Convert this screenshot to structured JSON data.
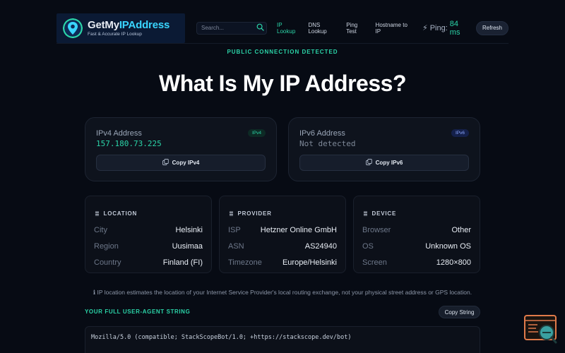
{
  "brand": {
    "title_main": "GetMy",
    "title_accent": "IPAddress",
    "tagline": "Fast & Accurate IP Lookup"
  },
  "search": {
    "placeholder": "Search..."
  },
  "nav": {
    "items": [
      {
        "label": "IP Lookup",
        "active": true
      },
      {
        "label": "DNS Lookup",
        "active": false
      },
      {
        "label": "Ping Test",
        "active": false
      },
      {
        "label": "Hostname to IP",
        "active": false
      }
    ]
  },
  "ping": {
    "label": "Ping:",
    "value": "84 ms"
  },
  "refresh_label": "Refresh",
  "status": "PUBLIC CONNECTION DETECTED",
  "page_title": "What Is My IP Address?",
  "ipv4": {
    "label": "IPv4 Address",
    "badge": "IPv4",
    "address": "157.180.73.225",
    "copy_label": "Copy IPv4"
  },
  "ipv6": {
    "label": "IPv6 Address",
    "badge": "IPv6",
    "address": "Not detected",
    "copy_label": "Copy IPv6"
  },
  "location": {
    "heading": "LOCATION",
    "rows": [
      {
        "key": "City",
        "value": "Helsinki"
      },
      {
        "key": "Region",
        "value": "Uusimaa"
      },
      {
        "key": "Country",
        "value": "Finland (FI)"
      }
    ]
  },
  "provider": {
    "heading": "PROVIDER",
    "rows": [
      {
        "key": "ISP",
        "value": "Hetzner Online GmbH"
      },
      {
        "key": "ASN",
        "value": "AS24940"
      },
      {
        "key": "Timezone",
        "value": "Europe/Helsinki"
      }
    ]
  },
  "device": {
    "heading": "DEVICE",
    "rows": [
      {
        "key": "Browser",
        "value": "Other"
      },
      {
        "key": "OS",
        "value": "Unknown OS"
      },
      {
        "key": "Screen",
        "value": "1280×800"
      }
    ]
  },
  "note": "ℹ IP location estimates the location of your Internet Service Provider's local routing exchange, not your physical street address or GPS location.",
  "user_agent": {
    "heading": "YOUR FULL USER-AGENT STRING",
    "copy_label": "Copy String",
    "value": "Mozilla/5.0 (compatible; StackScopeBot/1.0; +https://stackscope.dev/bot)"
  },
  "colors": {
    "accent": "#2bd4a8",
    "brand_accent": "#39d5ff",
    "background": "#070b14"
  }
}
